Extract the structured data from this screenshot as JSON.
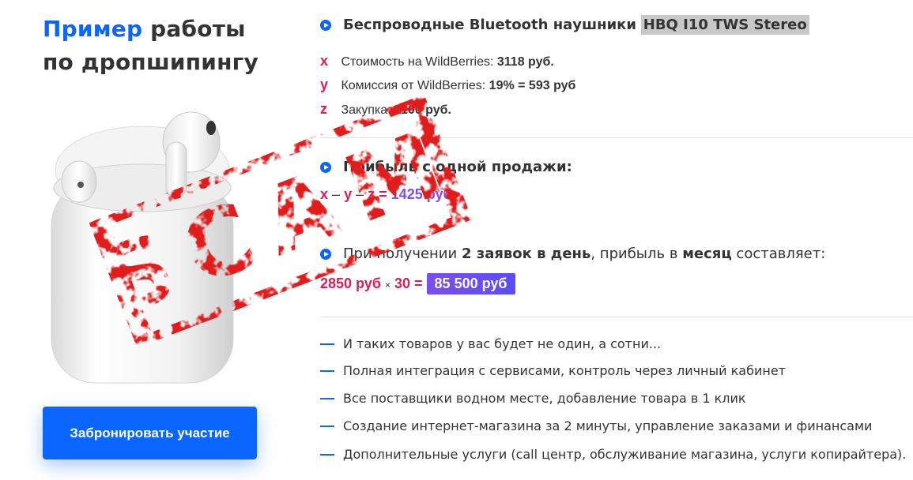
{
  "header": {
    "title_accent": "Пример",
    "title_rest_1": "работы",
    "title_rest_2": "по дропшипингу"
  },
  "cta": {
    "label": "Забронировать участие"
  },
  "product": {
    "name_prefix": "Беспроводные Bluetooth наушники",
    "name_model": "HBQ I10 TWS Stereo"
  },
  "costs": [
    {
      "var": "x",
      "label": "Стоимость на WildBerries:",
      "value": "3118 руб."
    },
    {
      "var": "y",
      "label": "Комиссия от WildBerries:",
      "value": "19% = 593 руб"
    },
    {
      "var": "z",
      "label": "Закупка:",
      "value": "1100 руб."
    }
  ],
  "profit_one": {
    "heading": "Прибыль с одной продажи:",
    "formula_x": "x",
    "formula_sep1": "–",
    "formula_y": "y",
    "formula_sep2": "–",
    "formula_z": "z",
    "formula_eq": "=",
    "formula_result": "1425 руб."
  },
  "profit_month": {
    "text_1": "При получении",
    "text_bold_1": "2 заявок в день",
    "text_2": ", прибыль в",
    "text_bold_2": "месяц",
    "text_3": "составляет:",
    "amount": "2850 руб",
    "times": "×",
    "days": "30 =",
    "total": "85 500 руб"
  },
  "features": [
    "И таких товаров у вас будет не один, а сотни...",
    "Полная интеграция с сервисами, контроль через личный кабинет",
    "Все поставщики водном месте, добавление товара в 1 клик",
    "Создание интернет-магазина за 2 минуты, управление заказами и финансами",
    "Дополнительные услуги (call центр, обслуживание магазина, услуги копирайтера)."
  ],
  "stamp": {
    "text": "SCAM"
  },
  "colors": {
    "accent": "#0a66ff",
    "pink": "#e0195a",
    "purple": "#7c4dff",
    "stamp_red": "#e11d1d"
  }
}
